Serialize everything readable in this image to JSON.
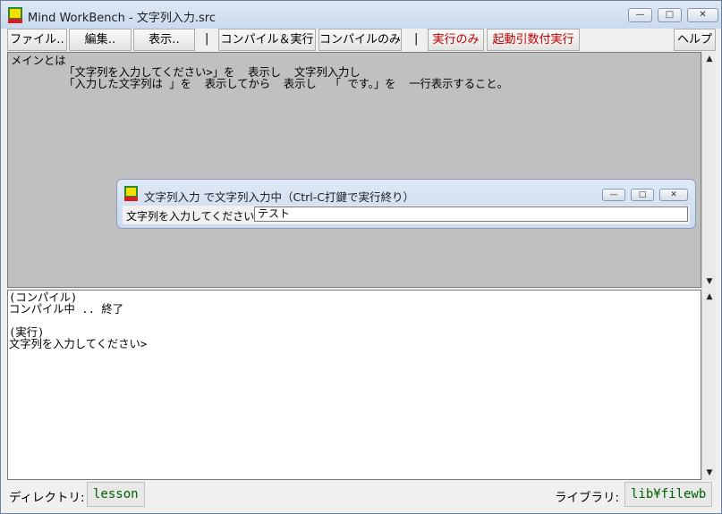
{
  "window": {
    "title": "Mind WorkBench - 文字列入力.src",
    "minimize": "—",
    "maximize": "□",
    "close": "✕"
  },
  "menu": {
    "file": "ファイル‥",
    "edit": "編集‥",
    "view": "表示‥",
    "sep": "|",
    "compile_run": "コンパイル＆実行",
    "compile_only": "コンパイルのみ",
    "run_only": "実行のみ",
    "run_with_args": "起動引数付実行",
    "help": "ヘルプ"
  },
  "source": {
    "lines": [
      "メインとは",
      "        「文字列を入力してください>」を  表示し  文字列入力し",
      "        「入力した文字列は 」を  表示してから  表示し  「 です。」を  一行表示すること。"
    ]
  },
  "dialog": {
    "title": "文字列入力 で文字列入力中（Ctrl-C打鍵で実行終り）",
    "prompt": "文字列を入力してください>",
    "input_value": "テスト"
  },
  "output": {
    "lines": [
      "(コンパイル)",
      "コンパイル中 .. 終了",
      "",
      "(実行)",
      "文字列を入力してください>"
    ]
  },
  "status": {
    "directory_label": "ディレクトリ:",
    "directory_value": "lesson",
    "library_label": "ライブラリ:",
    "library_value": "lib¥filewb"
  },
  "scroll": {
    "up": "▲",
    "down": "▼"
  }
}
